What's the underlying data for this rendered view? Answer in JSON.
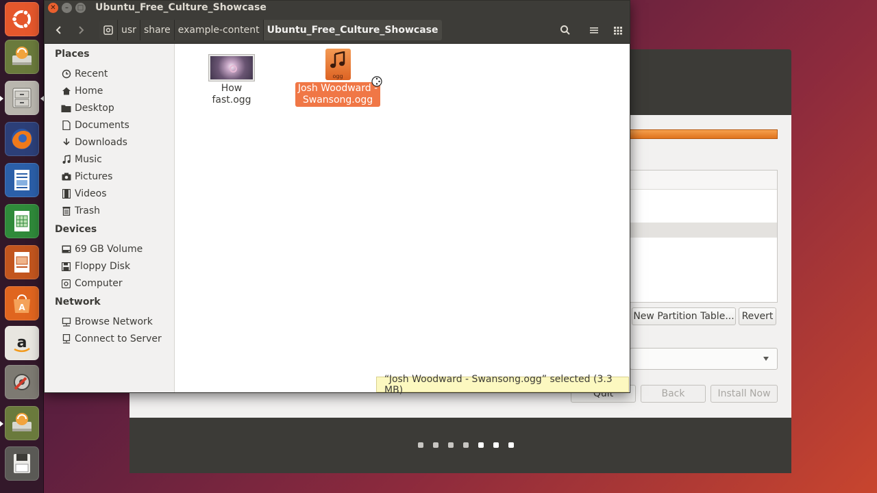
{
  "window": {
    "title": "Ubuntu_Free_Culture_Showcase"
  },
  "pathbar": {
    "crumbs": [
      "usr",
      "share",
      "example-content"
    ],
    "current": "Ubuntu_Free_Culture_Showcase"
  },
  "sidebar": {
    "places_header": "Places",
    "places": [
      "Recent",
      "Home",
      "Desktop",
      "Documents",
      "Downloads",
      "Music",
      "Pictures",
      "Videos",
      "Trash"
    ],
    "devices_header": "Devices",
    "devices": [
      "69 GB Volume",
      "Floppy Disk",
      "Computer"
    ],
    "network_header": "Network",
    "network": [
      "Browse Network",
      "Connect to Server"
    ]
  },
  "files": [
    {
      "name": "How fast.ogg"
    },
    {
      "name_line1": "Josh Woodward -",
      "name_line2": "Swansong.ogg",
      "ext": "ogg"
    }
  ],
  "status": "“Josh Woodward - Swansong.ogg” selected  (3.3 MB)",
  "installer": {
    "new_partition_table": "New Partition Table...",
    "revert": "Revert",
    "quit": "Quit",
    "back": "Back",
    "install_now": "Install Now"
  },
  "colors": {
    "selection": "#f07746",
    "launcher_bg": "#301828",
    "titlebar_bg": "#3d3c38"
  }
}
